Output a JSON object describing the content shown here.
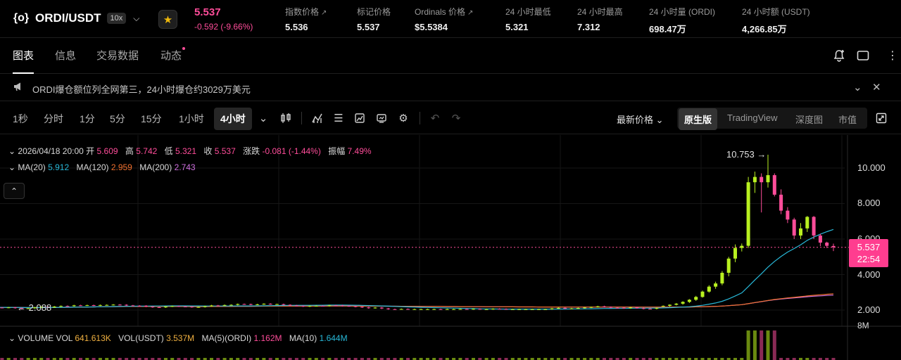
{
  "header": {
    "symbol": "ORDI/USDT",
    "leverage": "10x",
    "logo_glyph": "{o}",
    "last_price": "5.537",
    "change": "-0.592 (-9.66%)",
    "stats": [
      {
        "label": "指数价格",
        "value": "5.536",
        "has_link": true
      },
      {
        "label": "标记价格",
        "value": "5.537",
        "has_link": false
      },
      {
        "label": "Ordinals 价格",
        "value": "$5.5384",
        "has_link": true
      },
      {
        "label": "24 小时最低",
        "value": "5.321",
        "has_link": false
      },
      {
        "label": "24 小时最高",
        "value": "7.312",
        "has_link": false
      },
      {
        "label": "24 小时量 (ORDI)",
        "value": "698.47万",
        "has_link": false
      },
      {
        "label": "24 小时额 (USDT)",
        "value": "4,266.85万",
        "has_link": false
      }
    ]
  },
  "nav": {
    "tabs": [
      "图表",
      "信息",
      "交易数据",
      "动态"
    ],
    "active": 0
  },
  "notice": {
    "text": "ORDI爆仓额位列全网第三，24小时爆仓约3029万美元"
  },
  "toolbar": {
    "intervals": [
      "1秒",
      "分时",
      "1分",
      "5分",
      "15分",
      "1小时",
      "4小时"
    ],
    "active_interval": "4小时",
    "price_mode": "最新价格",
    "views": [
      "原生版",
      "TradingView",
      "深度图",
      "市值"
    ],
    "active_view": "原生版"
  },
  "legend": {
    "date": "2026/04/18 20:00",
    "open_label": "开",
    "open": "5.609",
    "high_label": "高",
    "high": "5.742",
    "low_label": "低",
    "low": "5.321",
    "close_label": "收",
    "close": "5.537",
    "change_label": "涨跌",
    "change": "-0.081 (-1.44%)",
    "amp_label": "振幅",
    "amp": "7.49%",
    "ma20_label": "MA(20)",
    "ma20": "5.912",
    "ma120_label": "MA(120)",
    "ma120": "2.959",
    "ma200_label": "MA(200)",
    "ma200": "2.743",
    "vol_title": "VOLUME",
    "vol_label": "VOL",
    "vol": "641.613K",
    "volusdt_label": "VOL(USDT)",
    "volusdt": "3.537M",
    "vma5_label": "MA(5)(ORDI)",
    "vma5": "1.162M",
    "vma10_label": "MA(10)",
    "vma10": "1.644M"
  },
  "chart": {
    "y_ticks": [
      "10.000",
      "8.000",
      "6.000",
      "4.000",
      "2.000"
    ],
    "price_tag": "5.537",
    "countdown": "22:54",
    "high_marker": "10.753",
    "low_marker": "2.088",
    "vol_axis_label": "8M"
  },
  "chart_data": {
    "type": "candlestick",
    "symbol": "ORDI/USDT",
    "interval": "4小时",
    "ylim": [
      1.5,
      11.2
    ],
    "y_ticks": [
      2,
      4,
      6,
      8,
      10
    ],
    "last_price": 5.537,
    "high_marker": 10.753,
    "low_marker": 2.088,
    "recent_candles": [
      {
        "o": 2.22,
        "h": 2.26,
        "l": 2.18,
        "c": 2.24
      },
      {
        "o": 2.24,
        "h": 2.32,
        "l": 2.2,
        "c": 2.3
      },
      {
        "o": 2.3,
        "h": 2.4,
        "l": 2.26,
        "c": 2.36
      },
      {
        "o": 2.36,
        "h": 2.5,
        "l": 2.3,
        "c": 2.46
      },
      {
        "o": 2.46,
        "h": 2.62,
        "l": 2.4,
        "c": 2.58
      },
      {
        "o": 2.58,
        "h": 2.8,
        "l": 2.52,
        "c": 2.74
      },
      {
        "o": 2.74,
        "h": 3.1,
        "l": 2.7,
        "c": 3.04
      },
      {
        "o": 3.04,
        "h": 3.4,
        "l": 2.98,
        "c": 3.32
      },
      {
        "o": 3.32,
        "h": 3.6,
        "l": 3.2,
        "c": 3.5
      },
      {
        "o": 3.5,
        "h": 4.2,
        "l": 3.4,
        "c": 4.1
      },
      {
        "o": 4.1,
        "h": 5.0,
        "l": 3.9,
        "c": 4.9
      },
      {
        "o": 4.9,
        "h": 5.7,
        "l": 4.7,
        "c": 5.5
      },
      {
        "o": 5.5,
        "h": 5.75,
        "l": 5.3,
        "c": 5.62
      },
      {
        "o": 5.62,
        "h": 9.5,
        "l": 5.5,
        "c": 9.2
      },
      {
        "o": 9.2,
        "h": 9.8,
        "l": 8.6,
        "c": 9.5
      },
      {
        "o": 9.5,
        "h": 9.7,
        "l": 7.5,
        "c": 9.2
      },
      {
        "o": 9.2,
        "h": 10.753,
        "l": 8.9,
        "c": 9.6
      },
      {
        "o": 9.6,
        "h": 9.7,
        "l": 8.4,
        "c": 8.5
      },
      {
        "o": 8.5,
        "h": 8.8,
        "l": 7.4,
        "c": 7.6
      },
      {
        "o": 7.6,
        "h": 7.8,
        "l": 6.9,
        "c": 7.1
      },
      {
        "o": 7.1,
        "h": 7.2,
        "l": 6.0,
        "c": 6.2
      },
      {
        "o": 6.2,
        "h": 6.9,
        "l": 6.0,
        "c": 6.6
      },
      {
        "o": 6.6,
        "h": 7.3,
        "l": 6.4,
        "c": 7.25
      },
      {
        "o": 7.25,
        "h": 7.3,
        "l": 6.0,
        "c": 6.2
      },
      {
        "o": 6.2,
        "h": 6.3,
        "l": 5.6,
        "c": 5.8
      },
      {
        "o": 5.8,
        "h": 5.85,
        "l": 5.5,
        "c": 5.62
      },
      {
        "o": 5.609,
        "h": 5.742,
        "l": 5.321,
        "c": 5.537
      }
    ]
  },
  "colors": {
    "up": "#b8f020",
    "down": "#ff4d9a",
    "ma20": "#28b8d8",
    "ma120": "#f0702e",
    "ma200": "#d070e0",
    "star": "#f0b90b"
  }
}
